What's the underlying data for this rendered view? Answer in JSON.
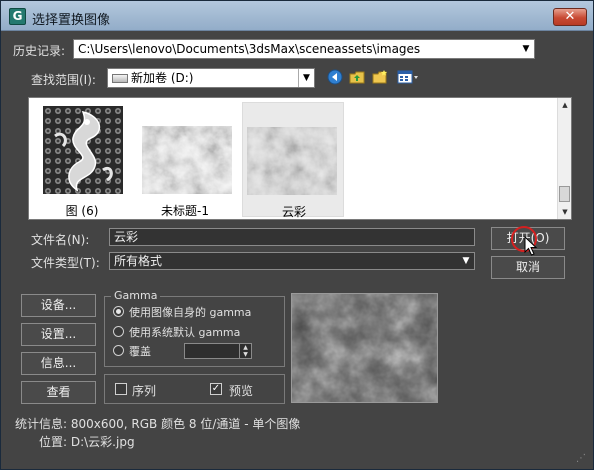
{
  "window": {
    "title": "选择置换图像",
    "app_icon_letter": "G",
    "close_glyph": "✕"
  },
  "history": {
    "label": "历史记录:",
    "value": "C:\\Users\\lenovo\\Documents\\3dsMax\\sceneassets\\images"
  },
  "look_in": {
    "label": "查找范围(I):",
    "value": "新加卷 (D:)",
    "drive_icon": "drive-icon"
  },
  "toolbar": {
    "icons": [
      "back-icon",
      "up-folder-icon",
      "new-folder-icon",
      "view-menu-icon"
    ]
  },
  "files": [
    {
      "name": "图 (6)",
      "selected": false
    },
    {
      "name": "未标题-1",
      "selected": false
    },
    {
      "name": "云彩",
      "selected": true
    }
  ],
  "filename": {
    "label": "文件名(N):",
    "value": "云彩"
  },
  "filetype": {
    "label": "文件类型(T):",
    "value": "所有格式"
  },
  "buttons": {
    "open": "打开(O)",
    "cancel": "取消",
    "setup1": "设备...",
    "setup2": "设置...",
    "info": "信息...",
    "view": "查看"
  },
  "gamma": {
    "title": "Gamma",
    "option1": "使用图像自身的 gamma",
    "option2": "使用系统默认 gamma",
    "option3": "覆盖",
    "selected": "option1"
  },
  "options": {
    "sequence": "序列",
    "sequence_checked": false,
    "preview": "预览",
    "preview_checked": true
  },
  "stats": {
    "line1": "统计信息: 800x600, RGB 颜色 8 位/通道 - 单个图像",
    "line2": "位置: D:\\云彩.jpg"
  },
  "colors": {
    "dialog_bg": "#444444",
    "titlebar": "#9fb7d0",
    "close_red": "#c84a33",
    "cursor_ring": "#d42020"
  }
}
